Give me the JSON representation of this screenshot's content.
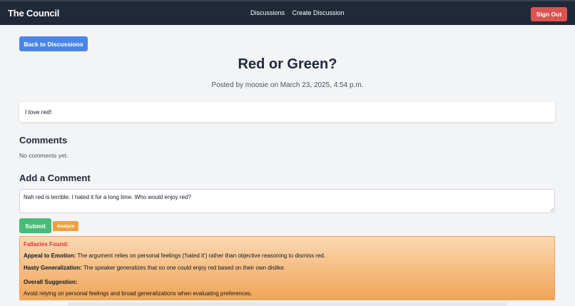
{
  "nav": {
    "brand": "The Council",
    "links": [
      "Discussions",
      "Create Discussion"
    ],
    "signout_label": "Sign Out"
  },
  "discussion": {
    "back_label": "Back to Discussions",
    "title": "Red or Green?",
    "meta": "Posted by moosie on March 23, 2025, 4:54 p.m.",
    "body": "I love red!"
  },
  "comments": {
    "heading": "Comments",
    "empty_text": "No comments yet."
  },
  "add_comment": {
    "heading": "Add a Comment",
    "value": "Nah red is terrible. I hated it for a long time. Who would enjoy red?",
    "submit_label": "Submit",
    "analyze_label": "Analyze"
  },
  "analysis": {
    "heading": "Fallacies Found:",
    "fallacies": [
      {
        "name": "Appeal to Emotion:",
        "text": "The argument relies on personal feelings ('hated it') rather than objective reasoning to dismiss red."
      },
      {
        "name": "Hasty Generalization:",
        "text": "The speaker generalizes that no one could enjoy red based on their own dislike."
      }
    ],
    "suggestion_heading": "Overall Suggestion:",
    "suggestion_text": "Avoid relying on personal feelings and broad generalizations when evaluating preferences."
  },
  "colors": {
    "navbar": "#1f2937",
    "signout": "#e05252",
    "back_button": "#4a86e8",
    "submit": "#48bb78",
    "analyze": "#eda140",
    "fallacy_heading": "#d9342b"
  }
}
